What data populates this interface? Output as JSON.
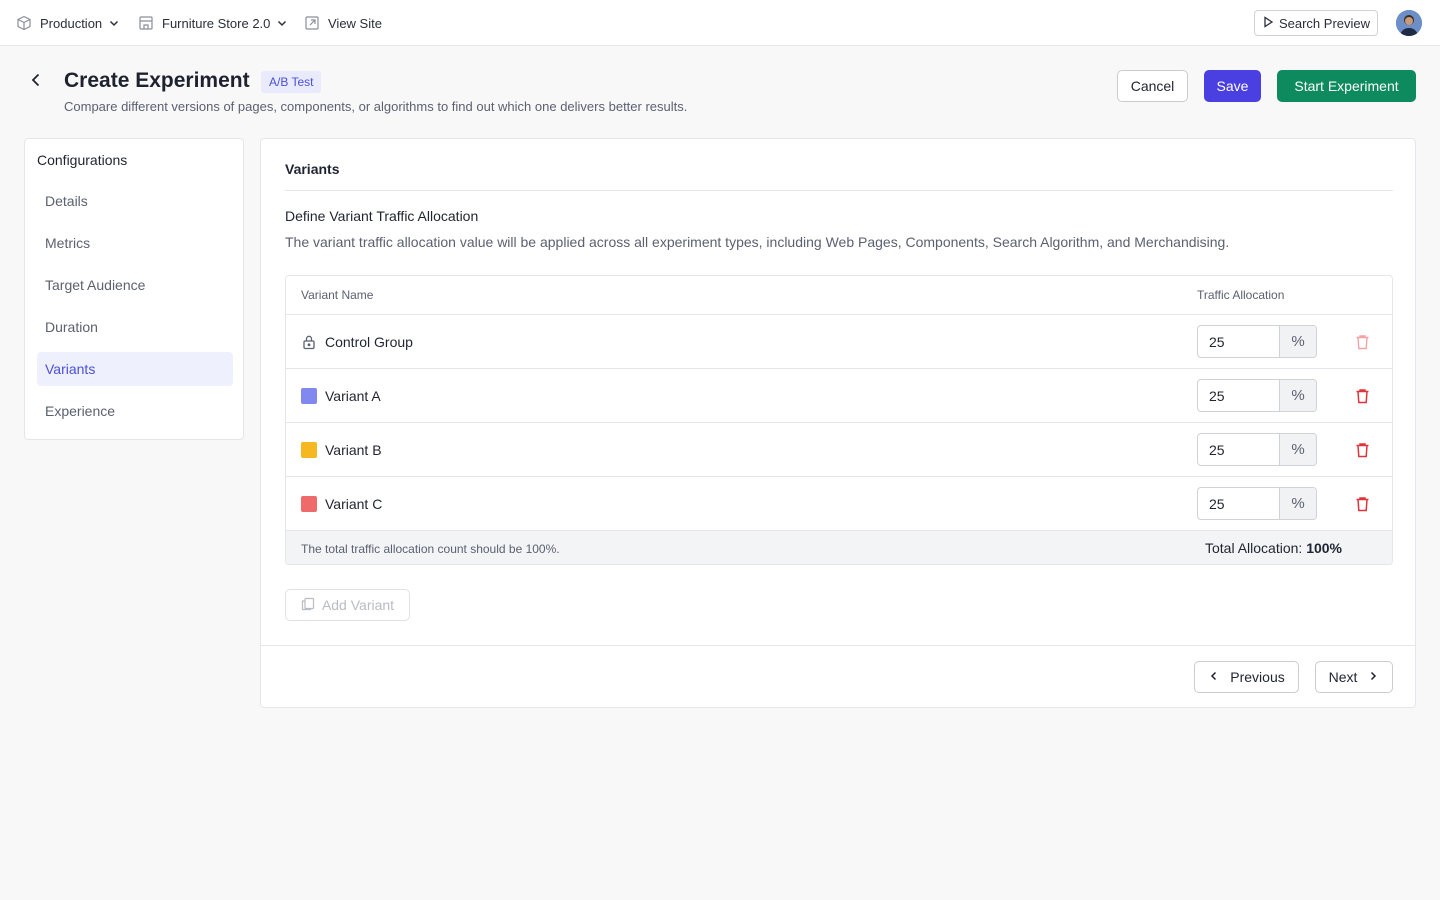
{
  "topbar": {
    "environment": "Production",
    "store": "Furniture Store 2.0",
    "view_site": "View Site",
    "search_preview": "Search Preview"
  },
  "header": {
    "title": "Create Experiment",
    "badge": "A/B Test",
    "subtitle": "Compare different versions of pages, components, or algorithms to find out which one delivers better results.",
    "cancel": "Cancel",
    "save": "Save",
    "start": "Start Experiment"
  },
  "sidebar": {
    "title": "Configurations",
    "items": [
      {
        "label": "Details"
      },
      {
        "label": "Metrics"
      },
      {
        "label": "Target Audience"
      },
      {
        "label": "Duration"
      },
      {
        "label": "Variants",
        "active": true
      },
      {
        "label": "Experience"
      }
    ]
  },
  "panel": {
    "title": "Variants",
    "section_title": "Define Variant Traffic Allocation",
    "section_desc": "The variant traffic allocation value will be applied across all experiment types, including Web Pages, Components, Search Algorithm, and Merchandising.",
    "table": {
      "col_name": "Variant Name",
      "col_alloc": "Traffic Allocation",
      "rows": [
        {
          "name": "Control Group",
          "value": "25",
          "unit": "%",
          "locked": true,
          "color": null
        },
        {
          "name": "Variant A",
          "value": "25",
          "unit": "%",
          "locked": false,
          "color": "#8189f0"
        },
        {
          "name": "Variant B",
          "value": "25",
          "unit": "%",
          "locked": false,
          "color": "#f5b820"
        },
        {
          "name": "Variant C",
          "value": "25",
          "unit": "%",
          "locked": false,
          "color": "#ef6b6b"
        }
      ],
      "footer_note": "The total traffic allocation count should be 100%.",
      "total_label": "Total Allocation:",
      "total_value": "100%"
    },
    "add_variant": "Add Variant",
    "previous": "Previous",
    "next": "Next"
  },
  "colors": {
    "accent": "#4a3fe0",
    "success": "#0e8a5f",
    "danger": "#e0343b"
  }
}
